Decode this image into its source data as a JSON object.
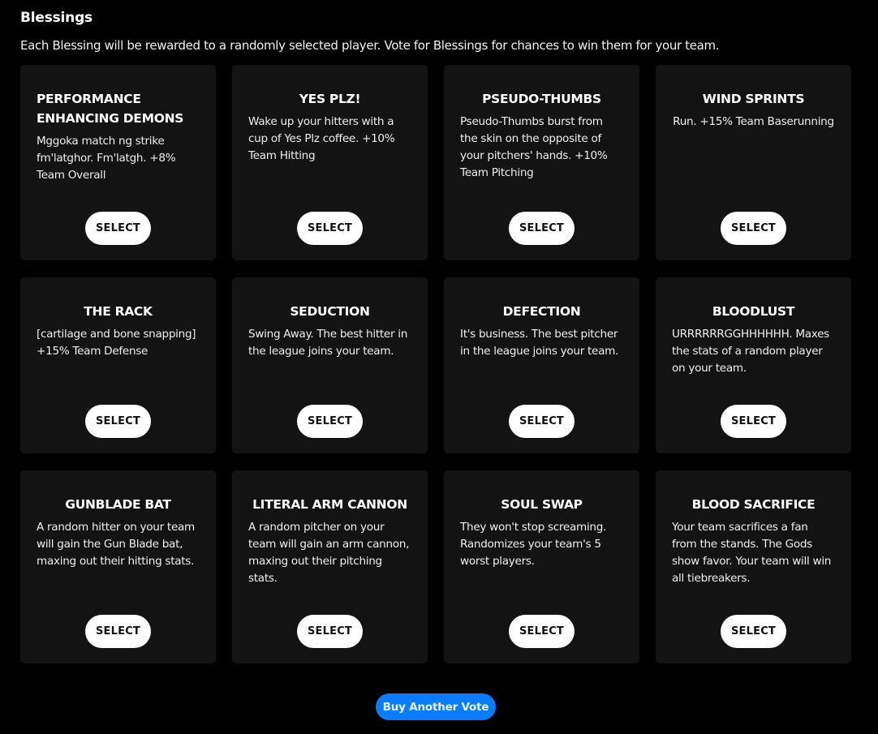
{
  "header": {
    "title": "Blessings",
    "intro": "Each Blessing will be rewarded to a randomly selected player. Vote for Blessings for chances to win them for your team."
  },
  "blessings": [
    {
      "title": "PERFORMANCE ENHANCING DEMONS",
      "description": "Mggoka match ng strike fm'latghor. Fm'latgh. +8% Team Overall",
      "button": "SELECT"
    },
    {
      "title": "YES PLZ!",
      "description": "Wake up your hitters with a cup of Yes Plz coffee. +10% Team Hitting",
      "button": "SELECT"
    },
    {
      "title": "PSEUDO-THUMBS",
      "description": "Pseudo-Thumbs burst from the skin on the opposite of your pitchers' hands. +10% Team Pitching",
      "button": "SELECT"
    },
    {
      "title": "WIND SPRINTS",
      "description": "Run. +15% Team Baserunning",
      "button": "SELECT"
    },
    {
      "title": "THE RACK",
      "description": "[cartilage and bone snapping] +15% Team Defense",
      "button": "SELECT"
    },
    {
      "title": "SEDUCTION",
      "description": "Swing Away. The best hitter in the league joins your team.",
      "button": "SELECT"
    },
    {
      "title": "DEFECTION",
      "description": "It's business. The best pitcher in the league joins your team.",
      "button": "SELECT"
    },
    {
      "title": "BLOODLUST",
      "description": "URRRRRRGGHHHHHH. Maxes the stats of a random player on your team.",
      "button": "SELECT"
    },
    {
      "title": "GUNBLADE BAT",
      "description": "A random hitter on your team will gain the Gun Blade bat, maxing out their hitting stats.",
      "button": "SELECT"
    },
    {
      "title": "LITERAL ARM CANNON",
      "description": "A random pitcher on your team will gain an arm cannon, maxing out their pitching stats.",
      "button": "SELECT"
    },
    {
      "title": "SOUL SWAP",
      "description": "They won't stop screaming. Randomizes your team's 5 worst players.",
      "button": "SELECT"
    },
    {
      "title": "BLOOD SACRIFICE",
      "description": "Your team sacrifices a fan from the stands. The Gods show favor. Your team will win all tiebreakers.",
      "button": "SELECT"
    }
  ],
  "footer": {
    "buy_vote_label": "Buy Another Vote"
  },
  "colors": {
    "background": "#000000",
    "card": "#131313",
    "accent_blue": "#0a7dff"
  }
}
